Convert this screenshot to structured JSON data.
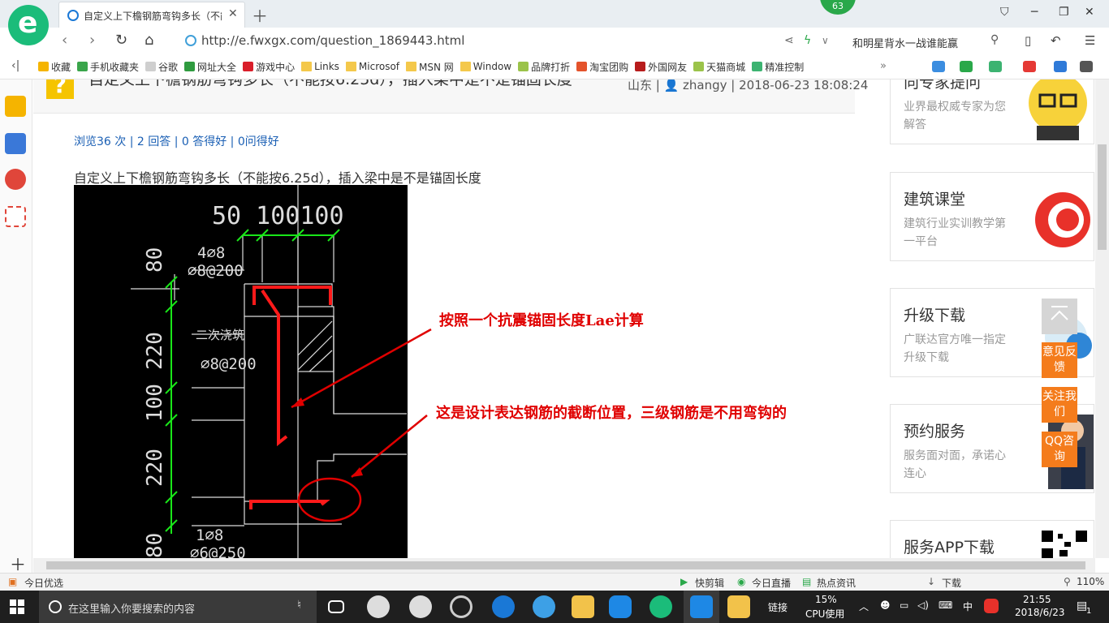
{
  "browser": {
    "tab_title": "自定义上下檐钢筋弯钩多长（不能",
    "tab_close": "✕",
    "new_tab": "＋",
    "badge": "63",
    "url": "http://e.fwxgx.com/question_1869443.html",
    "search_text": "和明星背水一战谁能赢",
    "bookmark_collapse": "‹|",
    "bookmarks_more": "»",
    "bookmarks": [
      {
        "label": "收藏",
        "icon": "star-icon",
        "color": "#f5b400"
      },
      {
        "label": "手机收藏夹",
        "icon": "phone-icon",
        "color": "#3aa54b"
      },
      {
        "label": "谷歌",
        "icon": "page-icon",
        "color": "#cfcfcf"
      },
      {
        "label": "网址大全",
        "icon": "globe-icon",
        "color": "#2f9b3f"
      },
      {
        "label": "游戏中心",
        "icon": "game-icon",
        "color": "#d91e2a"
      },
      {
        "label": "Links",
        "icon": "folder-icon",
        "color": "#f4c84b"
      },
      {
        "label": "Microsof",
        "icon": "folder-icon",
        "color": "#f4c84b"
      },
      {
        "label": "MSN 网",
        "icon": "folder-icon",
        "color": "#f4c84b"
      },
      {
        "label": "Window",
        "icon": "folder-icon",
        "color": "#f4c84b"
      },
      {
        "label": "品牌打折",
        "icon": "leaf-icon",
        "color": "#9bc34a"
      },
      {
        "label": "淘宝团购",
        "icon": "taobao-icon",
        "color": "#e4532b"
      },
      {
        "label": "外国网友",
        "icon": "flag-icon",
        "color": "#b71c1c"
      },
      {
        "label": "天猫商城",
        "icon": "leaf-icon",
        "color": "#9bc34a"
      },
      {
        "label": "精准控制",
        "icon": "wechat-icon",
        "color": "#3cb371"
      }
    ]
  },
  "question": {
    "icon": "?",
    "title": "自定义上下檐钢筋弯钩多长（不能按6.25d），插入梁中是不是锚固长度",
    "meta": "山东 | 👤 zhangy | 2018-06-23 18:08:24",
    "stats": "浏览36 次 | 2 回答 | 0 答得好 | 0问得好",
    "body": "自定义上下檐钢筋弯钩多长（不能按6.25d），插入梁中是不是锚固长度"
  },
  "drawing": {
    "dims_top": "50  100100",
    "left_labels": [
      "80",
      "220",
      "100",
      "220",
      "80"
    ],
    "rebar_label_1": "4⌀8",
    "rebar_label_2": "⌀8@200",
    "note": "二次浇筑",
    "rebar_label_3": "⌀8@200",
    "rebar_label_4": "1⌀8",
    "rebar_label_5": "⌀6@250"
  },
  "annotations": {
    "first": "按照一个抗震锚固长度Lae计算",
    "second": "这是设计表达钢筋的截断位置，三级钢筋是不用弯钩的"
  },
  "sidebar_ads": [
    {
      "title": "向专家提问",
      "sub": "业界最权威专家为您解答"
    },
    {
      "title": "建筑课堂",
      "sub": "建筑行业实训教学第一平台"
    },
    {
      "title": "升级下载",
      "sub": "广联达官方唯一指定升级下载"
    },
    {
      "title": "预约服务",
      "sub": "服务面对面，承诺心连心"
    },
    {
      "title": "服务APP下载",
      "sub": ""
    }
  ],
  "float_buttons": [
    "意见反馈",
    "关注我们",
    "QQ咨询"
  ],
  "statusbar": {
    "left": "今日优选",
    "items": [
      "快剪辑",
      "今日直播",
      "热点资讯",
      "下载"
    ],
    "zoom": "110%"
  },
  "taskbar": {
    "search_placeholder": "在这里输入你要搜索的内容",
    "link_label": "链接",
    "cpu_percent": "15%",
    "cpu_label": "CPU使用",
    "ime": "中",
    "time": "21:55",
    "date": "2018/6/23",
    "notifications": "1"
  }
}
